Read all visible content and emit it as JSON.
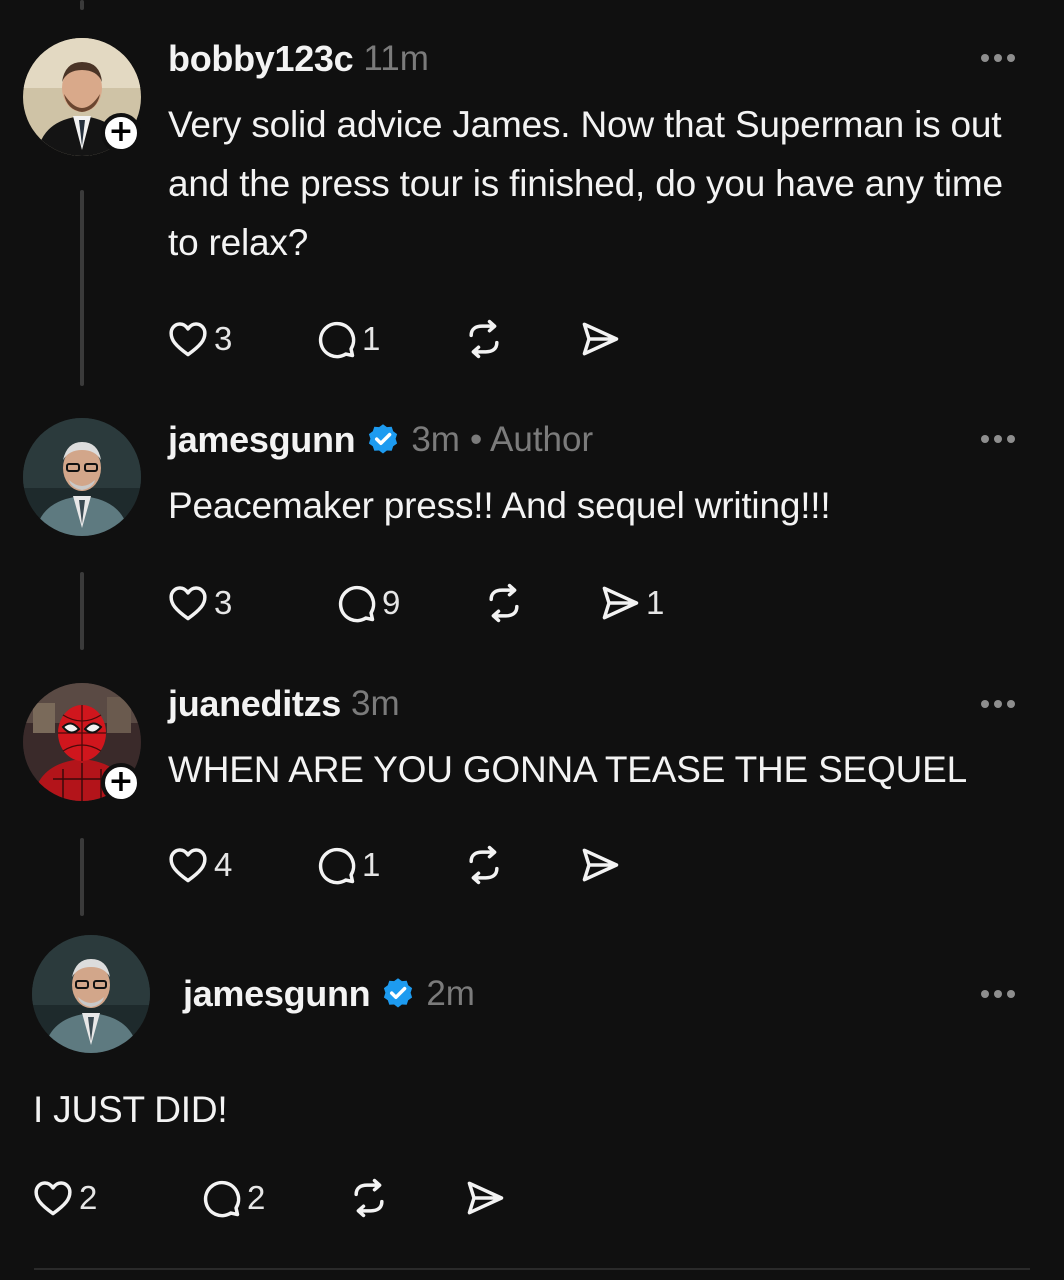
{
  "colors": {
    "background": "#101010",
    "muted": "#7b7b7b",
    "verified": "#1d9bf0",
    "text": "#f3f3f3"
  },
  "posts": [
    {
      "username": "bobby123c",
      "time": "11m",
      "author_tag": "",
      "text": "Very solid advice James. Now that Superman is out and the press tour is finished, do you have any time to relax?",
      "likes": "3",
      "replies": "1",
      "reposts": "",
      "shares": ""
    },
    {
      "username": "jamesgunn",
      "time": "3m",
      "author_tag": "• Author",
      "text": "Peacemaker press!! And sequel writing!!!",
      "likes": "3",
      "replies": "9",
      "reposts": "",
      "shares": "1"
    },
    {
      "username": "juaneditzs",
      "time": "3m",
      "author_tag": "",
      "text": "WHEN ARE YOU GONNA TEASE THE SEQUEL",
      "likes": "4",
      "replies": "1",
      "reposts": "",
      "shares": ""
    },
    {
      "username": "jamesgunn",
      "time": "2m",
      "author_tag": "",
      "text": "I JUST DID!",
      "likes": "2",
      "replies": "2",
      "reposts": "",
      "shares": ""
    }
  ],
  "icons": {
    "follow": "+",
    "verified": "verified-badge-icon",
    "more": "more-options-icon",
    "like": "heart-icon",
    "reply": "reply-bubble-icon",
    "repost": "repost-icon",
    "share": "send-icon"
  }
}
